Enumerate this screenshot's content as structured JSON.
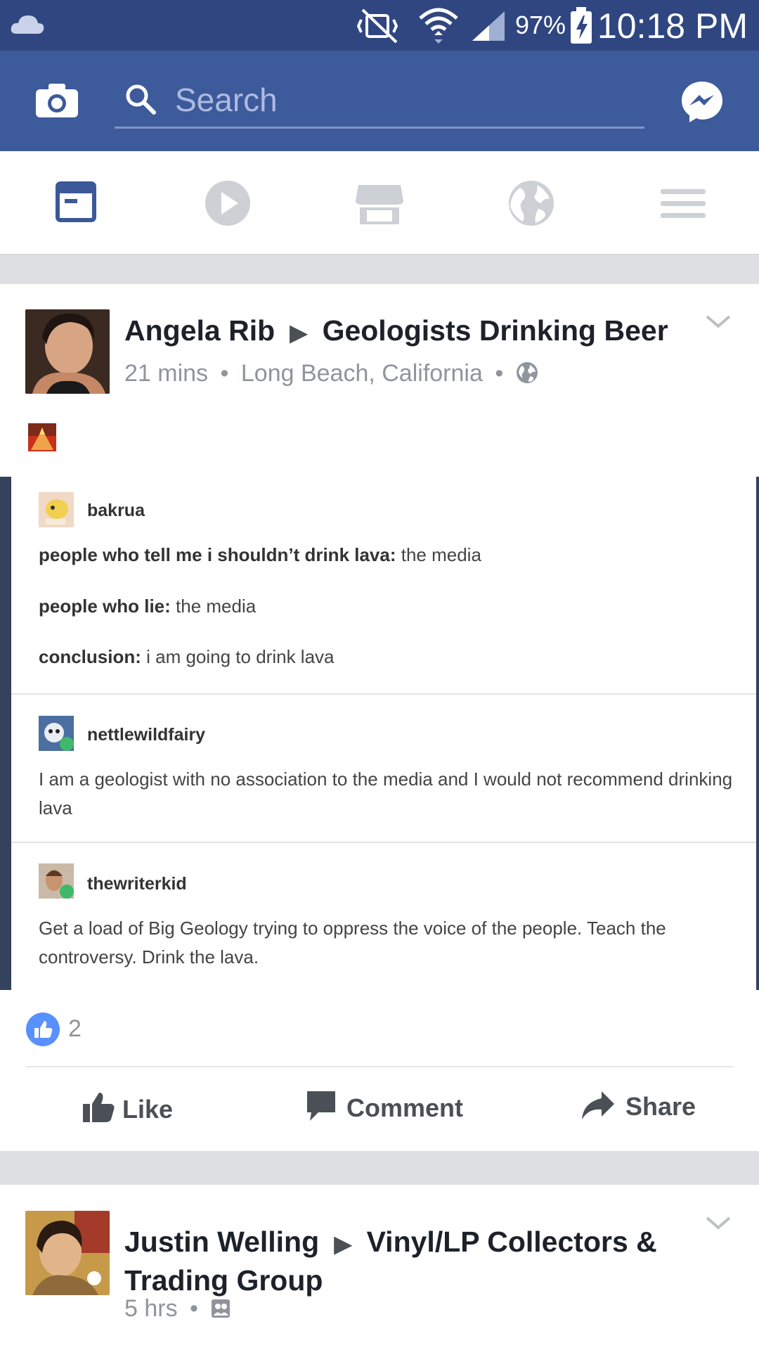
{
  "status_bar": {
    "battery_pct": "97%",
    "time": "10:18 PM",
    "icons": [
      "cloud-icon",
      "mute-vibrate-icon",
      "wifi-icon",
      "signal-icon",
      "battery-charging-icon"
    ]
  },
  "header": {
    "search_placeholder": "Search",
    "icons": [
      "camera-icon",
      "search-icon",
      "messenger-icon"
    ]
  },
  "tabs": [
    {
      "name": "news-feed-icon",
      "active": true
    },
    {
      "name": "video-icon",
      "active": false
    },
    {
      "name": "marketplace-icon",
      "active": false
    },
    {
      "name": "notifications-globe-icon",
      "active": false
    },
    {
      "name": "menu-icon",
      "active": false
    }
  ],
  "post1": {
    "author": "Angela Rib",
    "group": "Geologists Drinking Beer",
    "time": "21 mins",
    "location": "Long Beach, California",
    "dot": "•",
    "tumblr": {
      "user1": "bakrua",
      "l1_bold": "people who tell me i shouldn’t drink lava:",
      "l1_rest": " the media",
      "l2_bold": "people who lie:",
      "l2_rest": " the media",
      "l3_bold": "conclusion:",
      "l3_rest": " i am going to drink lava",
      "user2": "nettlewildfairy",
      "reply2": "I am a geologist with no association to the media and I would not recommend drinking lava",
      "user3": "thewriterkid",
      "reply3": "Get a load of Big Geology trying to oppress the voice of the people. Teach the controversy. Drink the lava."
    },
    "like_count": "2",
    "actions": {
      "like": "Like",
      "comment": "Comment",
      "share": "Share"
    }
  },
  "post2": {
    "author": "Justin Welling",
    "group_line1": "Vinyl/LP Collectors &",
    "group_line2": "Trading Group",
    "time": "5 hrs",
    "dot": "•"
  },
  "colors": {
    "brand": "#3d5a9b",
    "status": "#2f4680",
    "like_blue": "#5890ff"
  }
}
